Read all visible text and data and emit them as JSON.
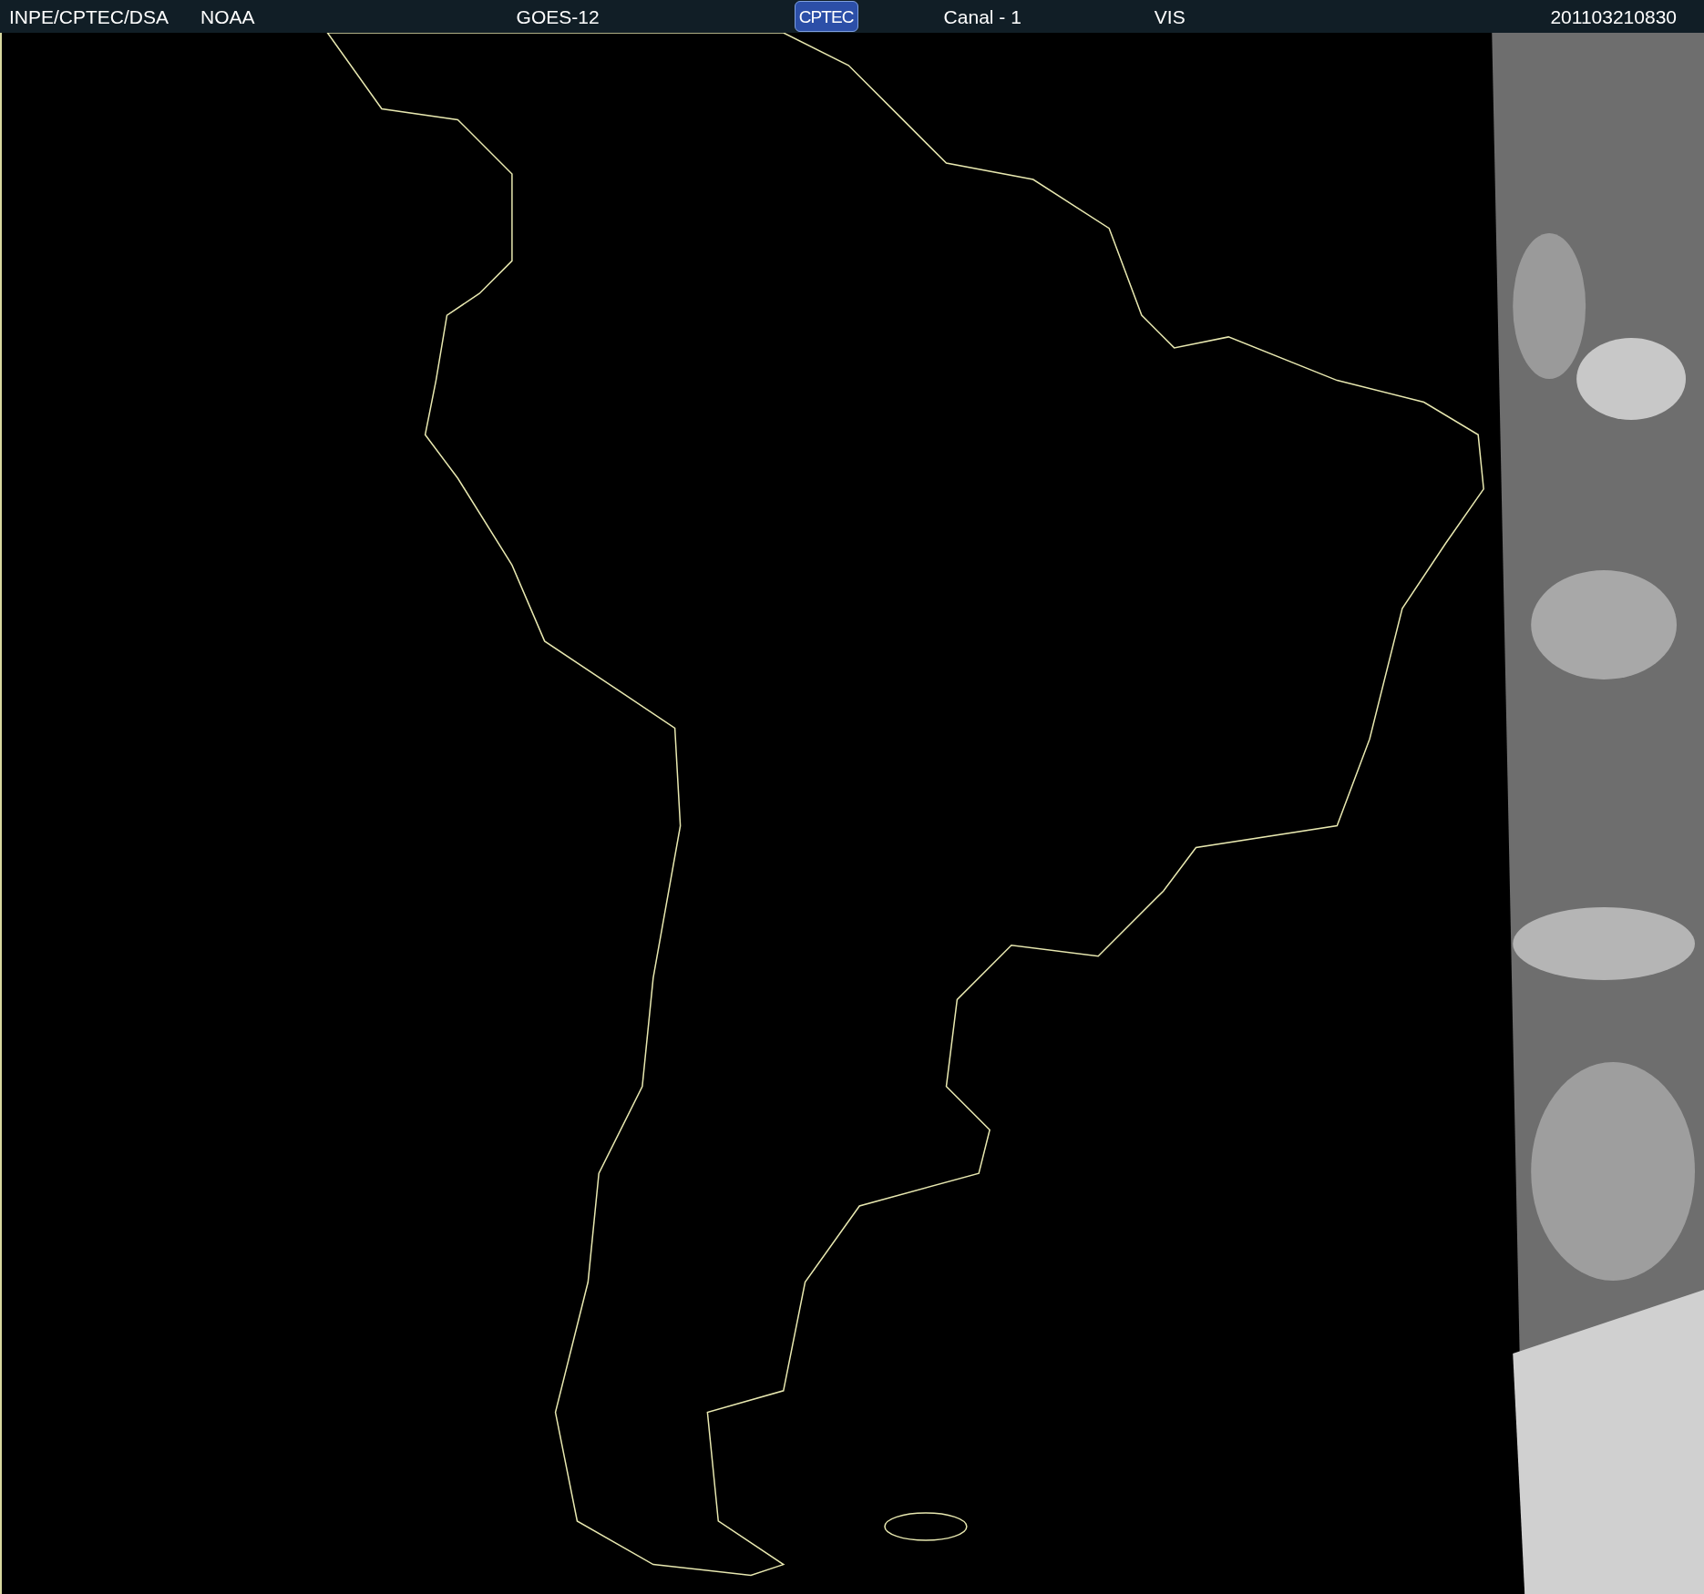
{
  "header": {
    "source": "INPE/CPTEC/DSA",
    "agency": "NOAA",
    "satellite": "GOES-12",
    "logo": "CPTEC",
    "channel": "Canal - 1",
    "band": "VIS",
    "timestamp": "201103210830"
  }
}
